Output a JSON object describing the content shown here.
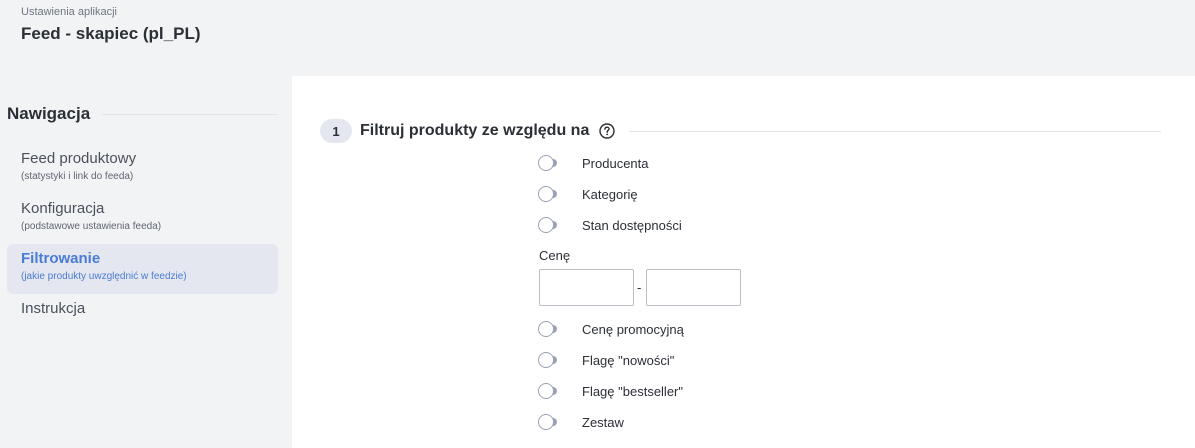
{
  "header": {
    "subtitle": "Ustawienia aplikacji",
    "title": "Feed - skapiec (pl_PL)"
  },
  "nav": {
    "heading": "Nawigacja",
    "items": [
      {
        "label": "Feed produktowy",
        "desc": "(statystyki i link do feeda)",
        "active": false
      },
      {
        "label": "Konfiguracja",
        "desc": "(podstawowe ustawienia feeda)",
        "active": false
      },
      {
        "label": "Filtrowanie",
        "desc": "(jakie produkty uwzględnić w feedzie)",
        "active": true
      },
      {
        "label": "Instrukcja",
        "desc": "",
        "active": false
      }
    ]
  },
  "section": {
    "number": "1",
    "title": "Filtruj produkty ze względu na",
    "help_icon": "question-circle-icon"
  },
  "filters": {
    "toggles_top": [
      {
        "label": "Producenta",
        "on": false
      },
      {
        "label": "Kategorię",
        "on": false
      },
      {
        "label": "Stan dostępności",
        "on": false
      }
    ],
    "price": {
      "label": "Cenę",
      "separator": "-",
      "min_value": "",
      "max_value": ""
    },
    "toggles_bottom": [
      {
        "label": "Cenę promocyjną",
        "on": false
      },
      {
        "label": "Flagę \"nowości\"",
        "on": false
      },
      {
        "label": "Flagę \"bestseller\"",
        "on": false
      },
      {
        "label": "Zestaw",
        "on": false
      }
    ]
  },
  "colors": {
    "accent": "#4a7bd6",
    "toggle_off": "#9aa2b6",
    "active_bg": "#e4e7ef"
  }
}
